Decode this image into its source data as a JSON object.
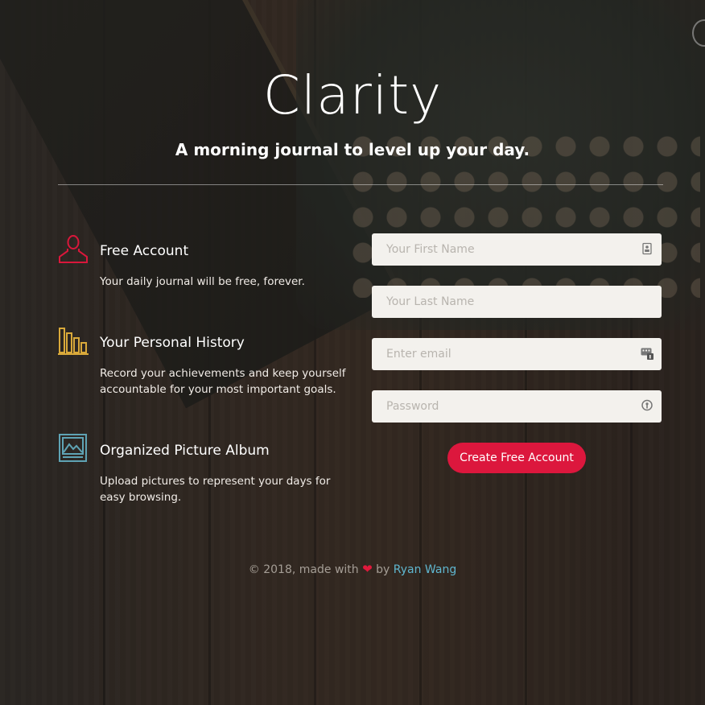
{
  "brand": {
    "title": "Clarity",
    "tagline": "A morning journal to level up your day."
  },
  "colors": {
    "accent": "#dc173d",
    "feature_icon_1": "#d9173b",
    "feature_icon_2": "#d9a93a",
    "feature_icon_3": "#5fa3b4",
    "link": "#5fb6cf"
  },
  "features": [
    {
      "icon": "user-icon",
      "heading": "Free Account",
      "description": "Your daily journal will be free, forever."
    },
    {
      "icon": "bar-chart-icon",
      "heading": "Your Personal History",
      "description": "Record your achievements and keep yourself accountable for your most important goals."
    },
    {
      "icon": "picture-icon",
      "heading": "Organized Picture Album",
      "description": "Upload pictures to represent your days for easy browsing."
    }
  ],
  "form": {
    "first_name": {
      "placeholder": "Your First Name",
      "value": "",
      "icon": "contact-card-icon"
    },
    "last_name": {
      "placeholder": "Your Last Name",
      "value": ""
    },
    "email": {
      "placeholder": "Enter email",
      "value": "",
      "icon": "keyboard-badge-icon"
    },
    "password": {
      "placeholder": "Password",
      "value": "",
      "icon": "key-icon"
    },
    "submit_label": "Create Free Account"
  },
  "footer": {
    "prefix": "© 2018, made with",
    "heart": "❤",
    "by": "by",
    "author": "Ryan Wang"
  }
}
